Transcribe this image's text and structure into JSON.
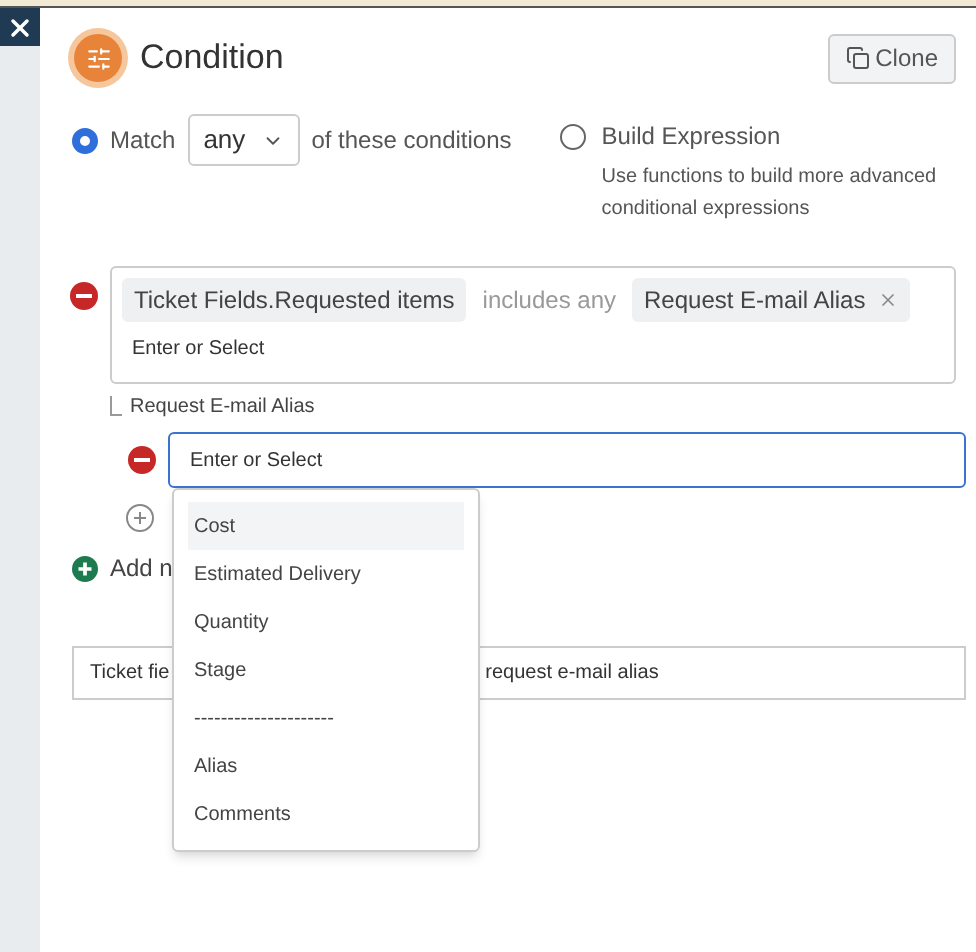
{
  "header": {
    "title": "Condition",
    "clone_button": "Clone"
  },
  "mode_options": [
    {
      "kind": "match",
      "selected": true,
      "label_before": "Match",
      "select_value": "any",
      "label_after": "of these conditions"
    },
    {
      "kind": "expression",
      "selected": false,
      "label": "Build Expression",
      "help": "Use functions to build more advanced conditional expressions"
    }
  ],
  "condition": {
    "field": "Ticket Fields.Requested items",
    "operator": "includes any",
    "values": [
      "Request E-mail Alias"
    ],
    "input_placeholder": "Enter or Select"
  },
  "sub_condition": {
    "label": "Request E-mail Alias",
    "input_placeholder": "Enter or Select"
  },
  "dropdown": {
    "items": [
      {
        "label": "Cost",
        "selected": true
      },
      {
        "label": "Estimated Delivery",
        "selected": false
      },
      {
        "label": "Quantity",
        "selected": false
      },
      {
        "label": "Stage",
        "selected": false
      },
      {
        "label": "---------------------",
        "selected": false
      },
      {
        "label": "Alias",
        "selected": false
      },
      {
        "label": "Comments",
        "selected": false
      }
    ]
  },
  "add_link": "Add n",
  "summary": [
    "Ticket fie",
    "request e-mail alias"
  ]
}
